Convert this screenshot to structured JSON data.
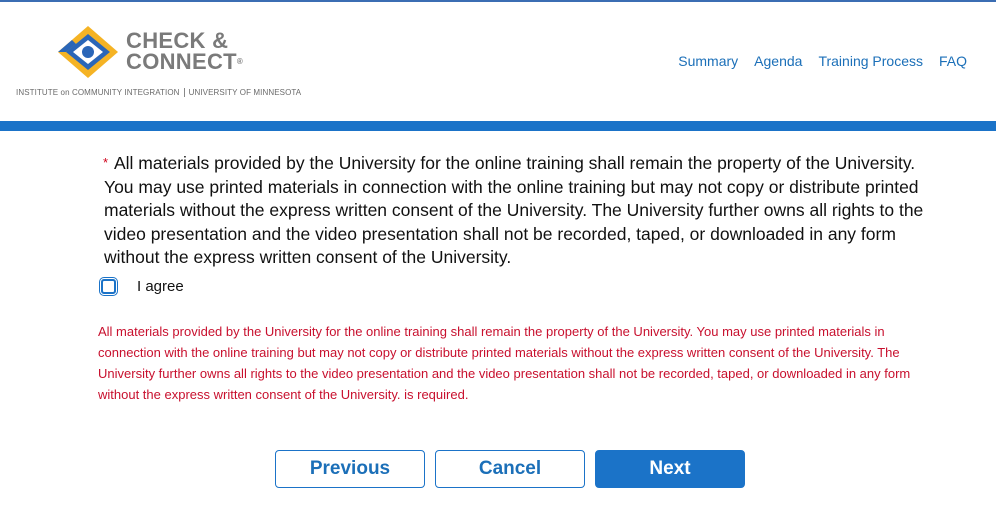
{
  "header": {
    "logo_line1": "CHECK &",
    "logo_line2": "CONNECT",
    "logo_tm": "®",
    "institute": "INSTITUTE on COMMUNITY INTEGRATION",
    "university": "UNIVERSITY OF MINNESOTA",
    "nav": [
      "Summary",
      "Agenda",
      "Training Process",
      "FAQ"
    ]
  },
  "form": {
    "required_mark": "*",
    "question": "All materials provided by the University for the online training shall remain the property of the University. You may use printed materials in connection with the online training but may not copy or distribute printed materials without the express written consent of the University. The University further owns all rights to the video presentation and the video presentation shall not be recorded, taped, or downloaded in any form without the express written consent of the University.",
    "checkbox_label": "I agree",
    "checkbox_checked": false,
    "error": "All materials provided by the University for the online training shall remain the property of the University. You may use printed materials in connection with the online training but may not copy or distribute printed materials without the express written consent of the University. The University further owns all rights to the video presentation and the video presentation shall not be recorded, taped, or downloaded in any form without the express written consent of the University. is required."
  },
  "buttons": {
    "previous": "Previous",
    "cancel": "Cancel",
    "next": "Next"
  },
  "colors": {
    "accent": "#1b73c8",
    "link": "#1b6fb8",
    "error": "#c8102e",
    "logo_gold": "#f5b324",
    "logo_blue": "#2a66b8"
  }
}
